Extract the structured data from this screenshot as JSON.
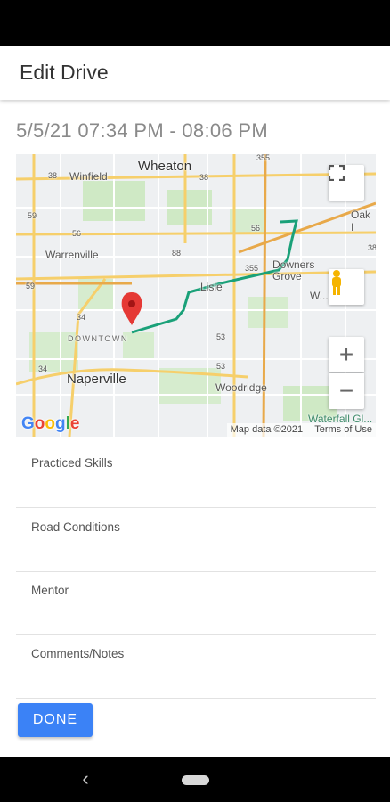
{
  "app_bar": {
    "title": "Edit Drive"
  },
  "drive": {
    "date_range": "5/5/21 07:34 PM - 08:06 PM"
  },
  "map": {
    "places": {
      "wheaton": "Wheaton",
      "winfield": "Winfield",
      "warrenville": "Warrenville",
      "naperville": "Naperville",
      "downtown": "DOWNTOWN",
      "lisle": "Lisle",
      "downers_grove": "Downers Grove",
      "woodridge": "Woodridge",
      "oak": "Oak I",
      "westmont": "W...mont",
      "waterfall": "Waterfall Gl..."
    },
    "routes": {
      "r38a": "38",
      "r56a": "56",
      "r59a": "59",
      "r59b": "59",
      "r38b": "38",
      "r355a": "355",
      "r355b": "355",
      "r56b": "56",
      "r88": "88",
      "r34a": "34",
      "r34b": "34",
      "r53a": "53",
      "r53b": "53",
      "r38c": "38"
    },
    "controls": {
      "zoom_in": "+",
      "zoom_out": "−"
    },
    "logo": "Google",
    "attribution": "Map data ©2021",
    "terms": "Terms of Use",
    "route_color": "#1aa179",
    "marker_color": "#e53935"
  },
  "fields": {
    "practiced_skills": "Practiced Skills",
    "road_conditions": "Road Conditions",
    "mentor": "Mentor",
    "comments_notes": "Comments/Notes"
  },
  "actions": {
    "done": "DONE"
  },
  "nav": {
    "back": "‹"
  }
}
